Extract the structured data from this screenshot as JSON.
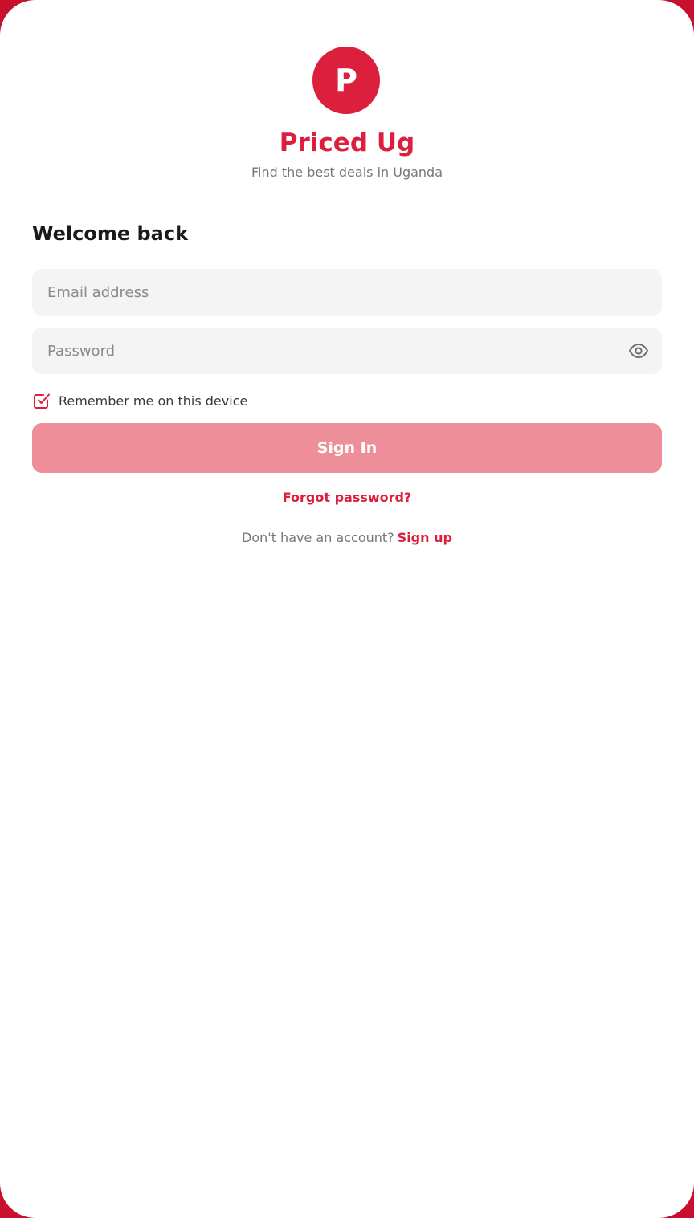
{
  "brand": {
    "logo_letter": "P",
    "name": "Priced Ug",
    "tagline": "Find the best deals in Uganda"
  },
  "login": {
    "heading": "Welcome back",
    "email_placeholder": "Email address",
    "email_value": "",
    "password_placeholder": "Password",
    "password_value": "",
    "password_toggle_icon": "eye-icon",
    "remember_label": "Remember me on this device",
    "remember_checked": true,
    "submit_label": "Sign In",
    "forgot_label": "Forgot password?",
    "signup_prompt": "Don't have an account?",
    "signup_label": "Sign up"
  },
  "colors": {
    "accent": "#dc1f3c",
    "button_disabled": "#ee8e99",
    "field_background": "#f4f4f4",
    "frame": "#c8102e"
  }
}
